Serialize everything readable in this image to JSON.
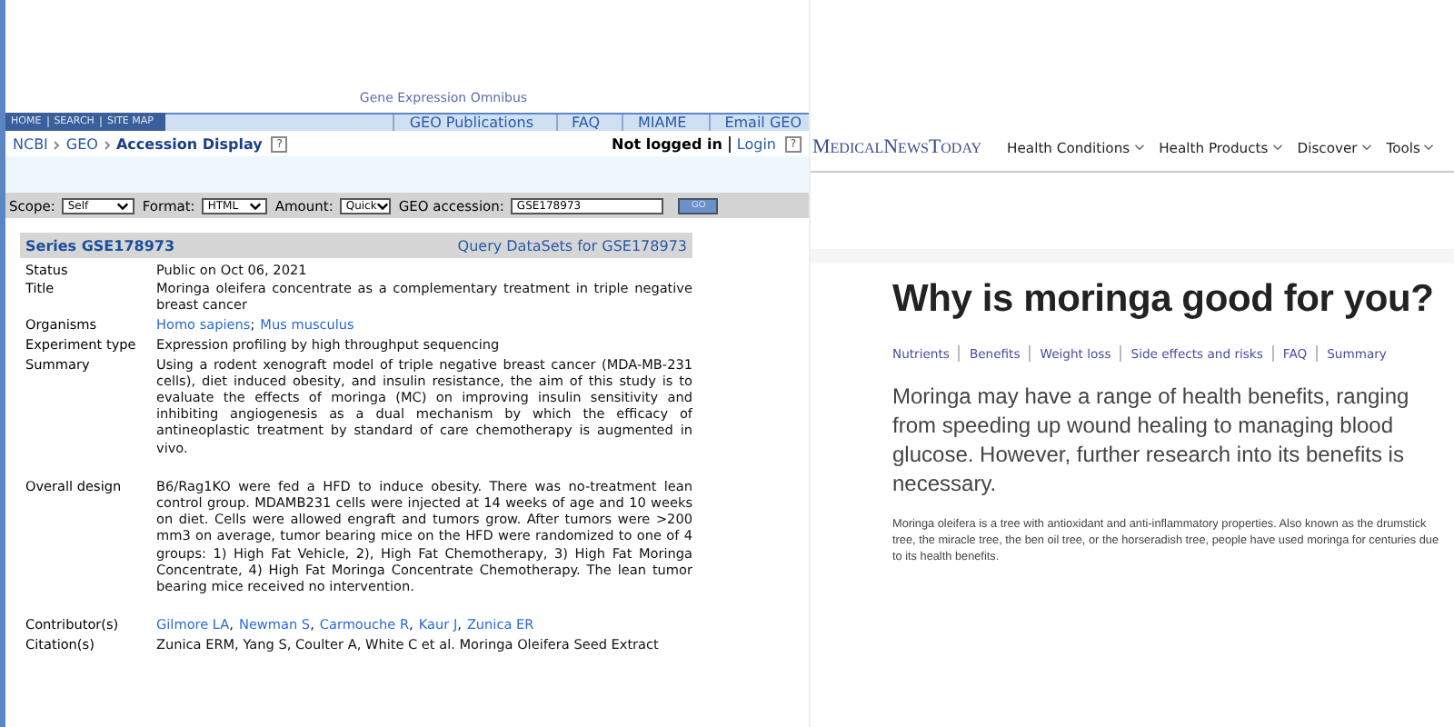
{
  "geo": {
    "banner": "Gene Expression Omnibus",
    "top_nav": [
      "HOME",
      "SEARCH",
      "SITE MAP"
    ],
    "links": [
      "GEO Publications",
      "FAQ",
      "MIAME",
      "Email GEO"
    ],
    "breadcrumb": [
      "NCBI",
      "GEO"
    ],
    "page_title": "Accession Display",
    "help": "?",
    "login_status": "Not logged in",
    "login_link": "Login",
    "form": {
      "scope_label": "Scope:",
      "scope": "Self",
      "format_label": "Format:",
      "format": "HTML",
      "amount_label": "Amount:",
      "amount": "Quick",
      "accession_label": "GEO accession:",
      "accession": "GSE178973",
      "go": "GO"
    },
    "series_title": "Series GSE178973",
    "query_link": "Query DataSets for GSE178973",
    "fields": [
      {
        "label": "Status",
        "kind": "text",
        "value": "Public on Oct 06, 2021"
      },
      {
        "label": "Title",
        "kind": "text",
        "value": "Moringa oleifera concentrate as a complementary treatment in triple negative breast cancer"
      },
      {
        "label": "Organisms",
        "kind": "links",
        "links": [
          "Homo sapiens",
          "Mus musculus"
        ],
        "separator": "; "
      },
      {
        "label": "Experiment type",
        "kind": "text",
        "value": "Expression profiling by high throughput sequencing"
      },
      {
        "label": "Summary",
        "kind": "text",
        "value": "Using a rodent xenograft model of triple negative breast cancer (MDA-MB-231 cells), diet induced obesity, and insulin resistance, the aim of this study is to evaluate the effects of moringa (MC) on improving insulin sensitivity and inhibiting angiogenesis as a dual mechanism by which the efficacy of antineoplastic treatment by standard of care chemotherapy is augmented in vivo."
      },
      {
        "label": "Overall design",
        "kind": "text",
        "value": "B6/Rag1KO were fed a HFD to induce obesity. There was no-treatment lean control group. MDAMB231 cells were injected at 14 weeks of age and 10 weeks on diet. Cells were allowed engraft and tumors grow. After tumors were >200 mm3 on average, tumor bearing mice on the HFD were randomized to one of 4 groups: 1) High Fat Vehicle, 2), High Fat Chemotherapy, 3) High Fat Moringa Concentrate, 4) High Fat Moringa Concentrate Chemotherapy. The lean tumor bearing mice received no intervention."
      },
      {
        "label": "Contributor(s)",
        "kind": "links",
        "links": [
          "Gilmore LA",
          "Newman S",
          "Carmouche R",
          "Kaur J",
          "Zunica ER"
        ],
        "separator": ", "
      },
      {
        "label": "Citation(s)",
        "kind": "text",
        "value": "Zunica ERM, Yang S, Coulter A, White C et al. Moringa Oleifera Seed Extract"
      }
    ]
  },
  "mnt": {
    "logo": "MedicalNewsToday",
    "nav": [
      "Health Conditions",
      "Health Products",
      "Discover",
      "Tools"
    ],
    "heading": "Why is moringa good for you?",
    "jump_links": [
      "Nutrients",
      "Benefits",
      "Weight loss",
      "Side effects and risks",
      "FAQ",
      "Summary"
    ],
    "lede": "Moringa may have a range of health benefits, ranging from speeding up wound healing to managing blood glucose. However, further research into its benefits is necessary.",
    "body": "Moringa oleifera is a tree with antioxidant and anti-inflammatory properties. Also known as the drumstick tree, the miracle tree, the ben oil tree, or the horseradish tree, people have used moringa for centuries due to its health benefits."
  }
}
